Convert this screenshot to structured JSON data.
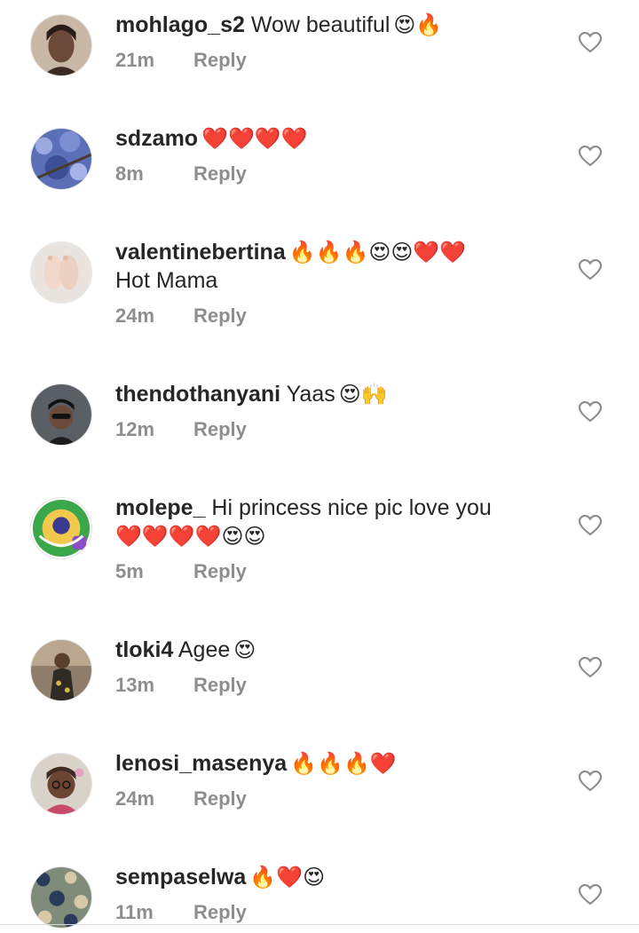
{
  "comments": [
    {
      "username": "mohlago_s2",
      "text": "Wow beautiful",
      "emoji": "😍🔥",
      "text2": "",
      "emoji2": "",
      "time": "21m",
      "reply": "Reply"
    },
    {
      "username": "sdzamo",
      "text": "",
      "emoji": "❤️❤️❤️❤️",
      "text2": "",
      "emoji2": "",
      "time": "8m",
      "reply": "Reply"
    },
    {
      "username": "valentinebertina",
      "text": "",
      "emoji": "🔥🔥🔥😍😍❤️❤️",
      "text2": "Hot Mama",
      "emoji2": "",
      "time": "24m",
      "reply": "Reply"
    },
    {
      "username": "thendothanyani",
      "text": "Yaas",
      "emoji": "😍🙌",
      "text2": "",
      "emoji2": "",
      "time": "12m",
      "reply": "Reply"
    },
    {
      "username": "molepe_",
      "text": "Hi princess nice pic love you",
      "emoji": "",
      "text2": "",
      "emoji2": "❤️❤️❤️❤️😍😍",
      "time": "5m",
      "reply": "Reply"
    },
    {
      "username": "tloki4",
      "text": "Agee",
      "emoji": "😍",
      "text2": "",
      "emoji2": "",
      "time": "13m",
      "reply": "Reply"
    },
    {
      "username": "lenosi_masenya",
      "text": "",
      "emoji": "🔥🔥🔥❤️",
      "text2": "",
      "emoji2": "",
      "time": "24m",
      "reply": "Reply"
    },
    {
      "username": "sempaselwa",
      "text": "",
      "emoji": "🔥❤️😍",
      "text2": "",
      "emoji2": "",
      "time": "11m",
      "reply": "Reply"
    }
  ],
  "avatars": [
    {
      "icon": "profile-photo",
      "bg": "#c9b8a6",
      "accent": "#3a2a22"
    },
    {
      "icon": "profile-photo",
      "bg": "#5a6fb5",
      "accent": "#9aa9e0"
    },
    {
      "icon": "profile-photo",
      "bg": "#e9e4df",
      "accent": "#d8c3b5"
    },
    {
      "icon": "profile-photo",
      "bg": "#5a5f66",
      "accent": "#1c1c1c"
    },
    {
      "icon": "profile-photo",
      "bg": "#3aa84a",
      "accent": "#f2c94c"
    },
    {
      "icon": "profile-photo",
      "bg": "#8d7d6a",
      "accent": "#2e2a24"
    },
    {
      "icon": "profile-photo",
      "bg": "#d9d2c8",
      "accent": "#3d2b24"
    },
    {
      "icon": "profile-photo",
      "bg": "#7f8c7a",
      "accent": "#2a3a5a"
    }
  ],
  "colors": {
    "text": "#262626",
    "muted": "#8e8e8e",
    "heart_outline": "#8e8e8e"
  }
}
